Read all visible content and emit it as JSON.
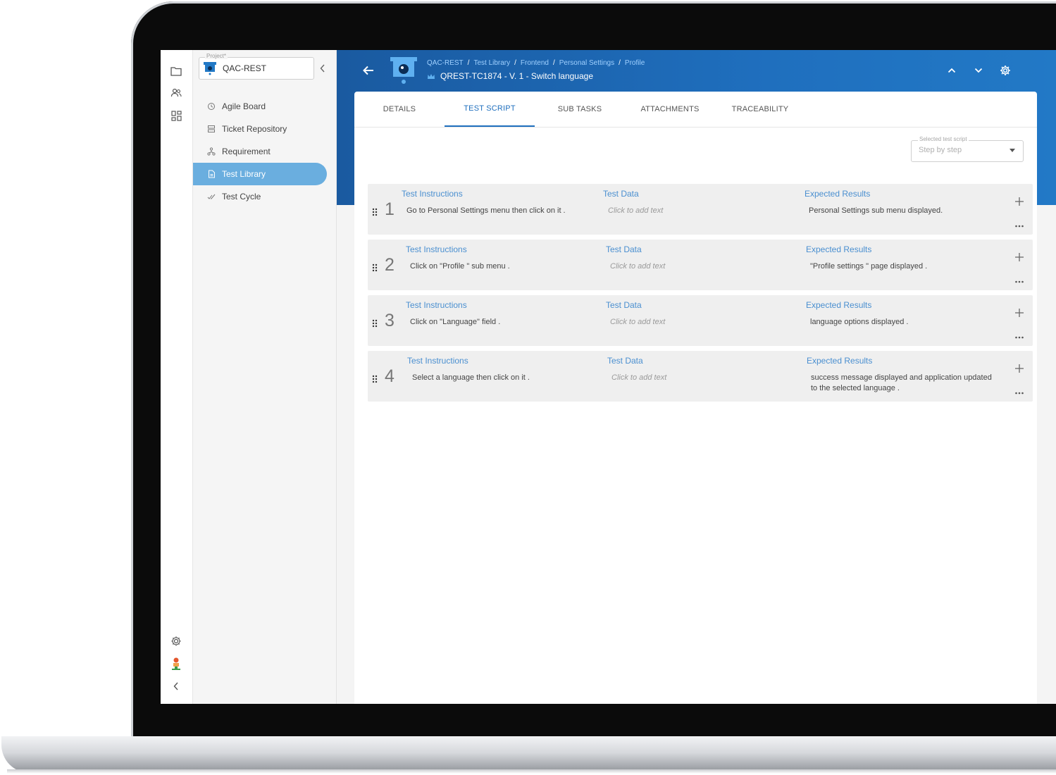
{
  "project": {
    "legend": "Project*",
    "name": "QAC-REST"
  },
  "nav": [
    {
      "label": "Agile Board",
      "icon": "history-icon"
    },
    {
      "label": "Ticket Repository",
      "icon": "server-icon"
    },
    {
      "label": "Requirement",
      "icon": "hierarchy-icon"
    },
    {
      "label": "Test Library",
      "icon": "document-icon"
    },
    {
      "label": "Test Cycle",
      "icon": "check-double-icon"
    }
  ],
  "breadcrumb": [
    "QAC-REST",
    "Test Library",
    "Frontend",
    "Personal Settings",
    "Profile"
  ],
  "ticket_title": "QREST-TC1874 - V. 1 - Switch language",
  "tabs": [
    "DETAILS",
    "TEST SCRIPT",
    "SUB TASKS",
    "ATTACHMENTS",
    "TRACEABILITY"
  ],
  "script_select": {
    "legend": "Selected test script",
    "value": "Step by step"
  },
  "steps": [
    {
      "number": "1",
      "instructions_label": "Test Instructions",
      "instructions": "Go to Personal Settings menu then click on it .",
      "data_label": "Test Data",
      "data": "Click to add text",
      "results_label": "Expected Results",
      "results": "Personal Settings sub menu displayed."
    },
    {
      "number": "2",
      "instructions_label": "Test Instructions",
      "instructions": "Click on \"Profile \" sub menu .",
      "data_label": "Test Data",
      "data": "Click to add text",
      "results_label": "Expected Results",
      "results": "\"Profile settings \" page displayed ."
    },
    {
      "number": "3",
      "instructions_label": "Test Instructions",
      "instructions": "Click on \"Language\" field .",
      "data_label": "Test Data",
      "data": "Click to add text",
      "results_label": "Expected Results",
      "results": "language options displayed ."
    },
    {
      "number": "4",
      "instructions_label": "Test Instructions",
      "instructions": "Select a language then click on it .",
      "data_label": "Test Data",
      "data": "Click to add text",
      "results_label": "Expected Results",
      "results": "success message displayed and application updated to the selected language ."
    }
  ],
  "colors": {
    "header": "#1f6fbe",
    "active_nav": "#6aaedf",
    "label_blue": "#4a8fd0"
  }
}
